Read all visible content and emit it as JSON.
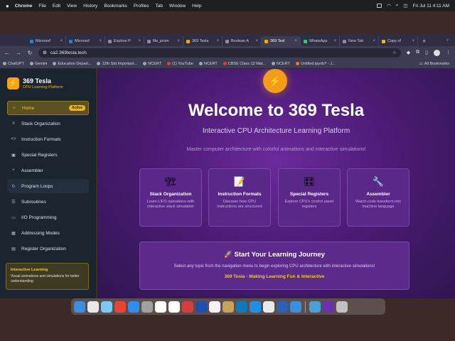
{
  "menubar": {
    "app": "Chrome",
    "items": [
      "File",
      "Edit",
      "View",
      "History",
      "Bookmarks",
      "Profiles",
      "Tab",
      "Window",
      "Help"
    ],
    "datetime": "Fri Jul 11  4:11 AM"
  },
  "tabs": [
    {
      "label": "Microsof",
      "color": "#2b7cd3"
    },
    {
      "label": "Microsof",
      "color": "#2b7cd3"
    },
    {
      "label": "Explore P",
      "color": "#8a8aa8"
    },
    {
      "label": "file_prom",
      "color": "#8a8aa8"
    },
    {
      "label": "369 Tesla",
      "color": "#f2a516"
    },
    {
      "label": "Boolean A",
      "color": "#8a8aa8"
    },
    {
      "label": "369 Tesl",
      "color": "#f2a516",
      "active": true
    },
    {
      "label": "WhatsApp",
      "color": "#25d366"
    },
    {
      "label": "New Tab",
      "color": "#8a8aa8"
    },
    {
      "label": "Copy of",
      "color": "#f4b400"
    }
  ],
  "url": "ca2.369tesla.tech",
  "bookmarks": [
    "ChatGPT",
    "Gemini",
    "Education Depart...",
    "12th Std Important...",
    "NCERT",
    "(1) YouTube",
    "NCERT",
    "CBSE Class 12 Mat...",
    "NCERT",
    "Untitled.ipynb? - J..."
  ],
  "bookmarks_all": "All Bookmarks",
  "sidebar": {
    "title": "369 Tesla",
    "subtitle": "CPU Learning Platform",
    "active_badge": "Active",
    "items": [
      {
        "label": "Home",
        "icon": "home-icon",
        "glyph": "⌂"
      },
      {
        "label": "Stack Organization",
        "icon": "stack-icon",
        "glyph": "≡"
      },
      {
        "label": "Instruction Formats",
        "icon": "code-icon",
        "glyph": "<>"
      },
      {
        "label": "Special Registers",
        "icon": "chip-icon",
        "glyph": "▣"
      },
      {
        "label": "Assembler",
        "icon": "branch-icon",
        "glyph": "⑂"
      },
      {
        "label": "Program Loops",
        "icon": "loop-icon",
        "glyph": "↻"
      },
      {
        "label": "Subroutines",
        "icon": "list-icon",
        "glyph": "☰"
      },
      {
        "label": "I/O Programming",
        "icon": "monitor-icon",
        "glyph": "▭"
      },
      {
        "label": "Addressing Modes",
        "icon": "grid-icon",
        "glyph": "▦"
      },
      {
        "label": "Register Organization",
        "icon": "server-icon",
        "glyph": "▤"
      }
    ],
    "info_title": "Interactive Learning",
    "info_body": "Visual animations and simulations for better understanding"
  },
  "main": {
    "heading": "Welcome to 369 Tesla",
    "subheading": "Interactive CPU Architecture Learning Platform",
    "tagline": "Master computer architecture with colorful animations and interactive simulations!",
    "cards": [
      {
        "title": "Stack Organization",
        "desc": "Learn LIFO operations with interactive stack simulation",
        "icon": "crane-icon",
        "glyph": "🏗"
      },
      {
        "title": "Instruction Formats",
        "desc": "Discover how CPU instructions are structured",
        "icon": "memo-icon",
        "glyph": "📝"
      },
      {
        "title": "Special Registers",
        "desc": "Explore CPU's control panel registers",
        "icon": "control-knobs-icon",
        "glyph": "🎛"
      },
      {
        "title": "Assembler",
        "desc": "Watch code transform into machine language",
        "icon": "wrench-icon",
        "glyph": "🔧"
      }
    ],
    "journey_title": "🚀 Start Your Learning Journey",
    "journey_desc": "Select any topic from the navigation menu to begin exploring CPU architecture with interactive simulations!",
    "journey_footer": "369 Tesla - Making Learning Fun & Interactive"
  },
  "dock": [
    "#3c8de0",
    "#e8e8e8",
    "#7ec8f4",
    "#ea4335",
    "#2f8cf0",
    "#a0a0a0",
    "#ffffff",
    "#ffffff",
    "#d93c3c",
    "#1e4fb0",
    "#f4f4f4",
    "#c8a25a",
    "#0f7ab8",
    "#1f8fe8",
    "#e8e8e8",
    "#2b5fb8",
    "#3a90e0",
    "#4aa0d8",
    "#6b2fb0",
    "#c0c0c0"
  ]
}
